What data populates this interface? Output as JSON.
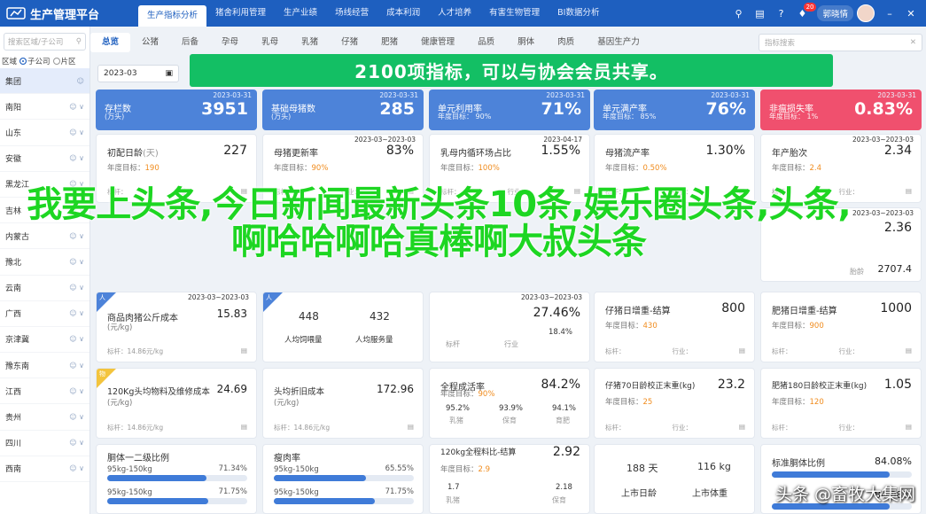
{
  "app": {
    "title": "生产管理平台"
  },
  "nav": [
    "生产指标分析",
    "猪舍利用管理",
    "生产业绩",
    "场线经营",
    "成本利润",
    "人才培养",
    "有害生物管理",
    "BI数据分析"
  ],
  "topbar": {
    "badge": "20",
    "user": "郭晓情"
  },
  "sidebar": {
    "search_placeholder": "搜索区域/子公司",
    "radios": [
      "区域",
      "子公司",
      "片区"
    ],
    "regions": [
      "集团",
      "南阳",
      "山东",
      "安徽",
      "黑龙江",
      "吉林",
      "内蒙古",
      "豫北",
      "云南",
      "广西",
      "京津冀",
      "豫东南",
      "江西",
      "贵州",
      "四川",
      "西南"
    ]
  },
  "tabs": [
    "总览",
    "公猪",
    "后备",
    "孕母",
    "乳母",
    "乳猪",
    "仔猪",
    "肥猪",
    "健康管理",
    "品质",
    "胴体",
    "肉质",
    "基因生产力"
  ],
  "keyword_placeholder": "指标搜索",
  "date_value": "2023-03",
  "banner": "2100项指标，可以与协会会员共享。",
  "kpi": [
    {
      "title": "存栏数",
      "sub": "(万头)",
      "value": "3951",
      "date": "2023-03-31"
    },
    {
      "title": "基础母猪数",
      "sub": "(万头)",
      "value": "285",
      "date": "2023-03-31"
    },
    {
      "title": "单元利用率",
      "sub": "年度目标： 90%",
      "value": "71%",
      "date": "2023-03-31"
    },
    {
      "title": "单元满产率",
      "sub": "年度目标： 85%",
      "value": "76%",
      "date": "2023-03-31"
    },
    {
      "title": "非瘟损失率",
      "sub": "年度目标： 1%",
      "value": "0.83%",
      "date": "2023-03-31"
    }
  ],
  "row2": [
    {
      "title": "初配日龄",
      "unit": "(天)",
      "value": "227",
      "target_label": "年度目标：",
      "target": "190",
      "date": ""
    },
    {
      "title": "母猪更新率",
      "unit": "",
      "value": "83%",
      "target_label": "年度目标：",
      "target": "90%",
      "date": "2023-03~2023-03"
    },
    {
      "title": "乳母内循环场占比",
      "unit": "",
      "value": "1.55%",
      "target_label": "年度目标：",
      "target": "100%",
      "date": "2023-04-17"
    },
    {
      "title": "母猪流产率",
      "unit": "",
      "value": "1.30%",
      "target_label": "年度目标：",
      "target": "0.50%",
      "date": ""
    },
    {
      "title": "年产胎次",
      "unit": "",
      "value": "2.34",
      "target_label": "年度目标：",
      "target": "2.4",
      "date": "2023-03~2023-03"
    }
  ],
  "row2_foot": [
    "标杆：",
    "行业："
  ],
  "row3_right": [
    {
      "value": "2.36",
      "date": "2023-03~2023-03"
    },
    {
      "value": "2707.4",
      "label": "胎龄"
    }
  ],
  "row4": [
    {
      "tag": "人",
      "date": "2023-03~2023-03",
      "title": "商品肉猪公斤成本",
      "unit": "(元/kg)",
      "value": "15.83",
      "foot": "标杆：14.86元/kg"
    },
    {
      "tag": "人",
      "a": "448",
      "b": "432",
      "la": "人均饲喂量",
      "lb": "人均服务量"
    },
    {
      "date": "2023-03~2023-03",
      "title": "",
      "value": "27.46%",
      "s1": "标杆",
      "s2": "行业",
      "v1": "",
      "v2": "18.4%"
    },
    {
      "title": "仔猪日增重-结算",
      "value": "800",
      "target": "430",
      "foot": "标杆：",
      "foot2": "行业："
    },
    {
      "title": "肥猪日增重-结算",
      "value": "1000",
      "target": "900",
      "foot": "标杆：",
      "foot2": "行业："
    }
  ],
  "row5": [
    {
      "tag": "物",
      "title": "120Kg头均物料及维修成本",
      "value": "24.69",
      "unit": "(元/kg)",
      "foot": "标杆：14.86元/kg"
    },
    {
      "title": "头均折旧成本",
      "value": "172.96",
      "unit": "(元/kg)",
      "foot": "标杆：14.86元/kg"
    },
    {
      "title": "全程成活率",
      "value": "84.2%",
      "target": "90%",
      "m": [
        [
          "95.2%",
          "乳猪"
        ],
        [
          "93.9%",
          "保育"
        ],
        [
          "94.1%",
          "育肥"
        ]
      ]
    },
    {
      "title": "仔猪70日龄校正末重(kg)",
      "value": "23.2",
      "target": "25",
      "foot": "标杆：",
      "foot2": "行业："
    },
    {
      "title": "肥猪180日龄校正末重(kg)",
      "value": "1.05",
      "target": "120",
      "foot": "标杆：",
      "foot2": "行业："
    }
  ],
  "row6": [
    {
      "title": "胴体一二级比例",
      "bars": [
        {
          "label": "95kg-150kg",
          "pct": "71.34%",
          "fill": 0.71
        },
        {
          "label": "95kg-150kg",
          "pct": "71.75%",
          "fill": 0.72
        }
      ]
    },
    {
      "title": "瘦肉率",
      "bars": [
        {
          "label": "95kg-150kg",
          "pct": "65.55%",
          "fill": 0.66
        },
        {
          "label": "95kg-150kg",
          "pct": "71.75%",
          "fill": 0.72
        }
      ]
    },
    {
      "title": "120kg全程料比-结算",
      "value": "2.92",
      "target": "2.9",
      "m": [
        [
          "1.7",
          "乳猪"
        ],
        [
          "2.18",
          "保育"
        ]
      ]
    },
    {
      "a": "188 天",
      "b": "116 kg",
      "la": "上市日龄",
      "lb": "上市体重"
    },
    {
      "title": "标准胴体比例",
      "pct": "84.08%",
      "fill": 0.84,
      "pct2": "84.08%",
      "fill2": 0.84
    }
  ],
  "overlay": "我要上头条,今日新闻最新头条10条,娱乐圈头条,头条,啊哈哈啊哈真棒啊大叔头条",
  "watermark": "头条 @畜牧大集网"
}
